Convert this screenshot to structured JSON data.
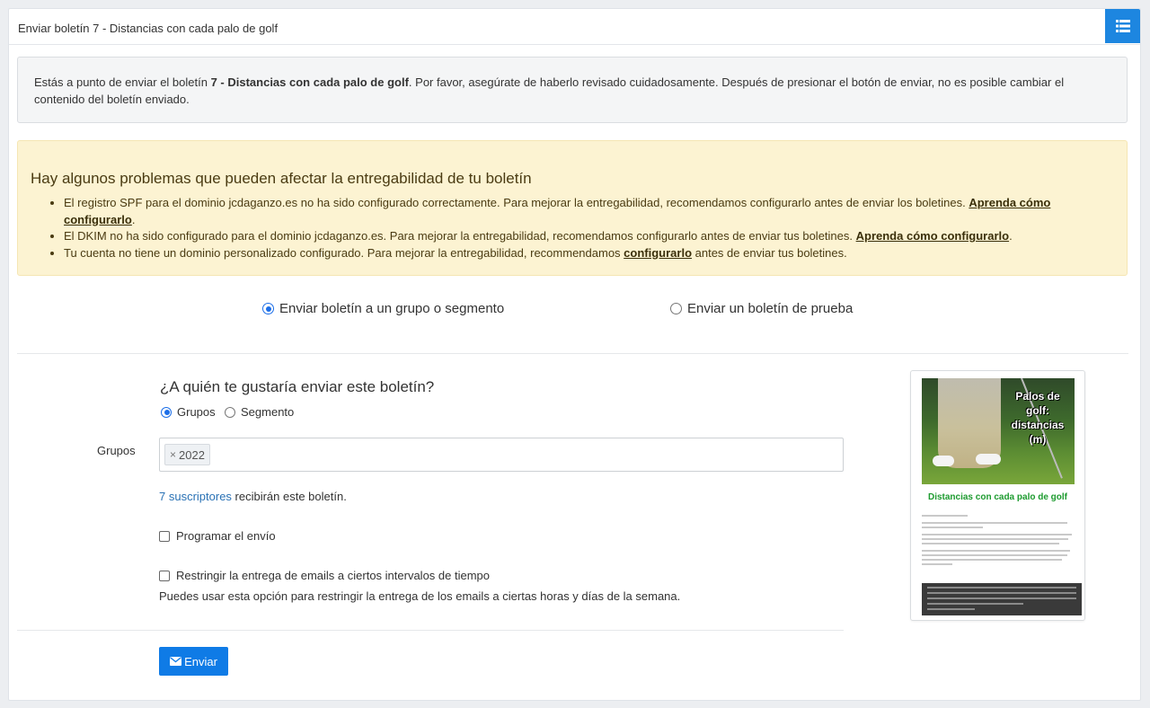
{
  "header": {
    "title": "Enviar boletín 7 - Distancias con cada palo de golf",
    "menu_icon": "list-icon"
  },
  "info": {
    "prefix": "Estás a punto de enviar el boletín ",
    "newsletter_name": "7 - Distancias con cada palo de golf",
    "suffix": ". Por favor, asegúrate de haberlo revisado cuidadosamente. Después de presionar el botón de enviar, no es posible cambiar el contenido del boletín enviado."
  },
  "warning": {
    "title": "Hay algunos problemas que pueden afectar la entregabilidad de tu boletín",
    "items": [
      {
        "text": "El registro SPF para el dominio jcdaganzo.es no ha sido configurado correctamente. Para mejorar la entregabilidad, recomendamos configurarlo antes de enviar los boletines. ",
        "link": "Aprenda cómo configurarlo",
        "after": "."
      },
      {
        "text": "El DKIM no ha sido configurado para el dominio jcdaganzo.es. Para mejorar la entregabilidad, recomendamos configurarlo antes de enviar tus boletines. ",
        "link": "Aprenda cómo configurarlo",
        "after": "."
      },
      {
        "text": "Tu cuenta no tiene un dominio personalizado configurado. Para mejorar la entregabilidad, recommendamos ",
        "link": "configurarlo",
        "after": " antes de enviar tus boletines."
      }
    ]
  },
  "send_mode": {
    "option_group": "Enviar boletín a un grupo o segmento",
    "option_test": "Enviar un boletín de prueba",
    "selected": "group"
  },
  "form": {
    "question": "¿A quién te gustaría enviar este boletín?",
    "target_groups": "Grupos",
    "target_segment": "Segmento",
    "target_selected": "Grupos",
    "groups_label": "Grupos",
    "group_tags": [
      "2022"
    ],
    "subscribers_link": "7 suscriptores",
    "subscribers_suffix": " recibirán este boletín.",
    "schedule_label": "Programar el envío",
    "restrict_label": "Restringir la entrega de emails a ciertos intervalos de tiempo",
    "restrict_help": "Puedes usar esta opción para restringir la entrega de los emails a ciertas horas y días de la semana.",
    "send_button": "Enviar",
    "send_icon": "envelope-icon"
  },
  "preview": {
    "image_caption_line1": "Palos de golf:",
    "image_caption_line2": "distancias (m)",
    "title": "Distancias con cada palo de golf"
  },
  "colors": {
    "accent": "#1d86e0",
    "warning_bg": "#fcf3d2",
    "preview_title": "#1d9b2f"
  }
}
